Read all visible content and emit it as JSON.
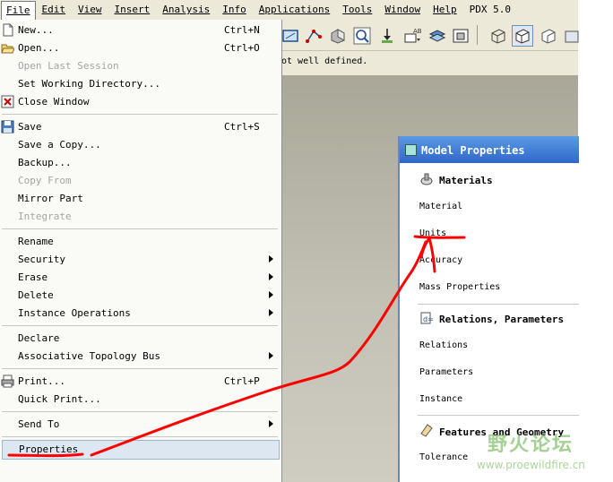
{
  "menubar": {
    "items": [
      {
        "label": "File",
        "mnemonic_index": 0
      },
      {
        "label": "Edit",
        "mnemonic_index": 0
      },
      {
        "label": "View",
        "mnemonic_index": 0
      },
      {
        "label": "Insert",
        "mnemonic_index": 0
      },
      {
        "label": "Analysis",
        "mnemonic_index": 0
      },
      {
        "label": "Info",
        "mnemonic_index": 0
      },
      {
        "label": "Applications",
        "mnemonic_index": 0
      },
      {
        "label": "Tools",
        "mnemonic_index": 0
      },
      {
        "label": "Window",
        "mnemonic_index": 0
      },
      {
        "label": "Help",
        "mnemonic_index": 0
      },
      {
        "label": "PDX 5.0",
        "mnemonic_index": -1
      }
    ]
  },
  "message": {
    "text": "ot well defined."
  },
  "file_menu": {
    "new": {
      "label": "New...",
      "shortcut": "Ctrl+N"
    },
    "open": {
      "label": "Open...",
      "shortcut": "Ctrl+O"
    },
    "open_last_session": {
      "label": "Open Last Session"
    },
    "set_working_directory": {
      "label": "Set Working Directory..."
    },
    "close_window": {
      "label": "Close Window"
    },
    "save": {
      "label": "Save",
      "shortcut": "Ctrl+S"
    },
    "save_a_copy": {
      "label": "Save a Copy..."
    },
    "backup": {
      "label": "Backup..."
    },
    "copy_from": {
      "label": "Copy From"
    },
    "mirror_part": {
      "label": "Mirror Part"
    },
    "integrate": {
      "label": "Integrate"
    },
    "rename": {
      "label": "Rename"
    },
    "security": {
      "label": "Security"
    },
    "erase": {
      "label": "Erase"
    },
    "delete": {
      "label": "Delete"
    },
    "instance_operations": {
      "label": "Instance Operations"
    },
    "declare": {
      "label": "Declare"
    },
    "associative_topology_bus": {
      "label": "Associative Topology Bus"
    },
    "print": {
      "label": "Print...",
      "shortcut": "Ctrl+P"
    },
    "quick_print": {
      "label": "Quick Print..."
    },
    "send_to": {
      "label": "Send To"
    },
    "properties": {
      "label": "Properties"
    }
  },
  "dialog": {
    "title": "Model Properties",
    "materials": {
      "heading": "Materials",
      "rows": [
        "Material",
        "Units",
        "Accuracy",
        "Mass Properties"
      ]
    },
    "relations": {
      "heading": "Relations, Parameters",
      "rows": [
        "Relations",
        "Parameters",
        "Instance"
      ]
    },
    "features": {
      "heading": "Features and Geometry",
      "rows": [
        "Tolerance"
      ]
    }
  },
  "watermark": {
    "chinese": "野火论坛",
    "url": "www.proewildfire.cn"
  },
  "colors": {
    "annotation_red": "#ff0000",
    "title_bar": "#2f67c9",
    "highlight": "#dde7f1"
  }
}
